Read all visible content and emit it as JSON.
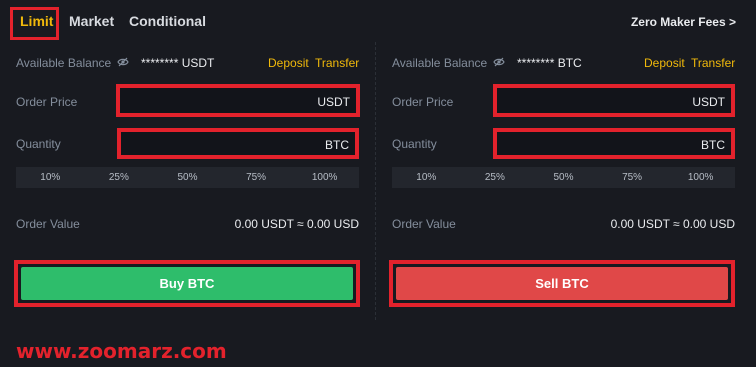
{
  "tabs": {
    "limit": "Limit",
    "market": "Market",
    "conditional": "Conditional"
  },
  "zero_maker_fees": "Zero Maker Fees >",
  "buy_panel": {
    "balance_label": "Available Balance",
    "balance_value": "******** USDT",
    "deposit": "Deposit",
    "transfer": "Transfer",
    "order_price_label": "Order Price",
    "order_price_value": "",
    "order_price_unit": "USDT",
    "quantity_label": "Quantity",
    "quantity_value": "",
    "quantity_unit": "BTC",
    "percentages": [
      "10%",
      "25%",
      "50%",
      "75%",
      "100%"
    ],
    "order_value_label": "Order Value",
    "order_value": "0.00 USDT ≈ 0.00 USD",
    "button_label": "Buy BTC"
  },
  "sell_panel": {
    "balance_label": "Available Balance",
    "balance_value": "******** BTC",
    "deposit": "Deposit",
    "transfer": "Transfer",
    "order_price_label": "Order Price",
    "order_price_value": "",
    "order_price_unit": "USDT",
    "quantity_label": "Quantity",
    "quantity_value": "",
    "quantity_unit": "BTC",
    "percentages": [
      "10%",
      "25%",
      "50%",
      "75%",
      "100%"
    ],
    "order_value_label": "Order Value",
    "order_value": "0.00 USDT ≈ 0.00 USD",
    "button_label": "Sell BTC"
  },
  "watermark": "www.zoomarz.com",
  "colors": {
    "accent": "#f0b90b",
    "buy": "#2ebd6b",
    "sell": "#e04848",
    "highlight": "#e3222c",
    "background": "#181a20"
  },
  "icons": {
    "balance_visibility": "eye-slash-icon"
  }
}
